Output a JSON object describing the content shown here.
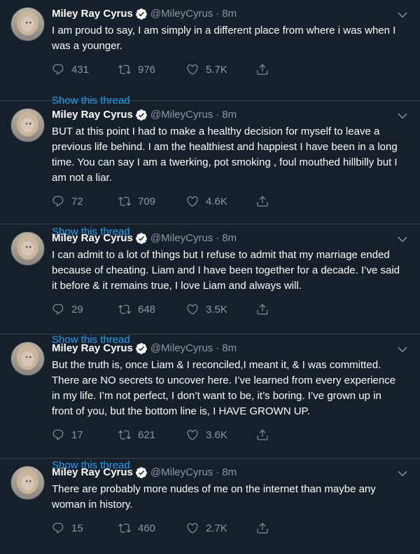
{
  "author": {
    "name": "Miley Ray Cyrus",
    "handle": "@MileyCyrus",
    "separator": "·",
    "time": "8m"
  },
  "show_thread_label": "Show this thread",
  "colors": {
    "background": "#15202b",
    "accent": "#1da1f2",
    "secondary_text": "#8899a6",
    "divider": "#38444d"
  },
  "tweets": [
    {
      "text": "I am proud to say, I am simply in a different place from where i was when I was a younger.",
      "replies": "431",
      "retweets": "976",
      "likes": "5.7K"
    },
    {
      "text": "BUT at this point I had to make a healthy decision for myself to leave a previous life behind. I am the healthiest and happiest I have been in a long time.  You can say I am a twerking, pot smoking , foul mouthed hillbilly but I am not a liar.",
      "replies": "72",
      "retweets": "709",
      "likes": "4.6K"
    },
    {
      "text": "I can admit to a lot of things but I refuse to admit that my marriage ended because of cheating. Liam and I have been together for a decade. I’ve said it before & it remains true, I love Liam and always will.",
      "replies": "29",
      "retweets": "648",
      "likes": "3.5K"
    },
    {
      "text": "But the truth is, once Liam & I reconciled,I meant it, & I was committed. There are NO secrets to uncover here. I’ve learned from every experience in my life. I’m not perfect, I don’t want to be, it’s boring. I’ve grown up in front of you, but the bottom line is, I HAVE GROWN UP.",
      "replies": "17",
      "retweets": "621",
      "likes": "3.6K"
    },
    {
      "text": "There are probably more nudes of me on the internet than maybe any woman in history.",
      "replies": "15",
      "retweets": "460",
      "likes": "2.7K"
    }
  ],
  "icons": {
    "reply": "reply-icon",
    "retweet": "retweet-icon",
    "like": "heart-icon",
    "share": "share-icon",
    "verified": "verified-badge-icon",
    "more": "chevron-down-icon"
  }
}
